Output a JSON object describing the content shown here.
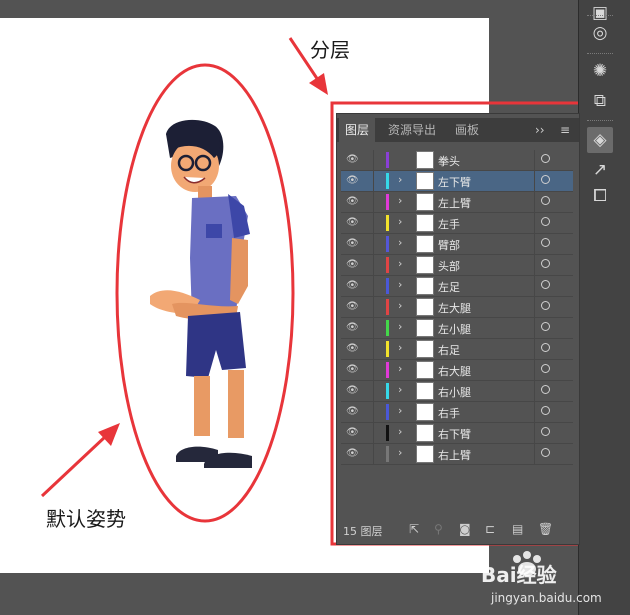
{
  "annotations": {
    "layers_label": "分层",
    "pose_label": "默认姿势"
  },
  "panel": {
    "tabs": [
      {
        "label": "图层"
      },
      {
        "label": "资源导出"
      },
      {
        "label": "画板"
      }
    ],
    "tab_controls": {
      "expand": "››",
      "menu": "≡"
    },
    "layers": [
      {
        "name": "拳头",
        "color": "#8a3fd6",
        "selected": false,
        "expandable": false
      },
      {
        "name": "左下臂",
        "color": "#36d8e8",
        "selected": true,
        "expandable": true
      },
      {
        "name": "左上臂",
        "color": "#e03ad8",
        "selected": false,
        "expandable": true
      },
      {
        "name": "左手",
        "color": "#f2e22c",
        "selected": false,
        "expandable": true
      },
      {
        "name": "臂部",
        "color": "#5457d8",
        "selected": false,
        "expandable": true
      },
      {
        "name": "头部",
        "color": "#e04444",
        "selected": false,
        "expandable": true
      },
      {
        "name": "左足",
        "color": "#4a58d8",
        "selected": false,
        "expandable": true
      },
      {
        "name": "左大腿",
        "color": "#e04444",
        "selected": false,
        "expandable": true
      },
      {
        "name": "左小腿",
        "color": "#44d84a",
        "selected": false,
        "expandable": true
      },
      {
        "name": "右足",
        "color": "#f2e22c",
        "selected": false,
        "expandable": true
      },
      {
        "name": "右大腿",
        "color": "#e03ad8",
        "selected": false,
        "expandable": true
      },
      {
        "name": "右小腿",
        "color": "#36d8e8",
        "selected": false,
        "expandable": true
      },
      {
        "name": "右手",
        "color": "#4a58d8",
        "selected": false,
        "expandable": true
      },
      {
        "name": "右下臂",
        "color": "#111111",
        "selected": false,
        "expandable": true
      },
      {
        "name": "右上臂",
        "color": "#777777",
        "selected": false,
        "expandable": true
      }
    ],
    "footer": {
      "count_label": "15 图层"
    }
  },
  "watermark": {
    "brand": "Bai经验",
    "url": "jingyan.baidu.com"
  },
  "colors": {
    "annotation_red": "#e8353a",
    "selection_blue": "#4a6685"
  }
}
